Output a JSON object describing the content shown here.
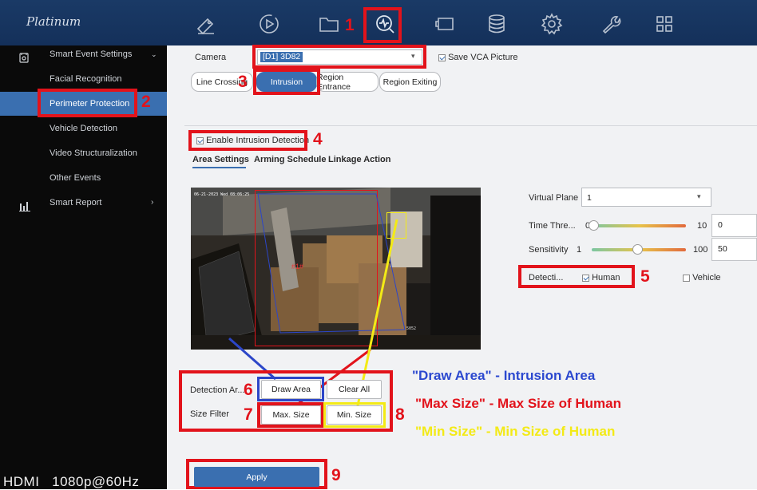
{
  "brand": "Platinum",
  "nav": {
    "icons": [
      "camera-icon",
      "playback-icon",
      "folder-icon",
      "smart-event-icon",
      "display-icon",
      "storage-icon",
      "settings-icon",
      "maintenance-icon",
      "apps-icon"
    ],
    "active_index": 3
  },
  "sidebar": {
    "items": [
      {
        "label": "Smart Event Settings",
        "icon": "smart-event-settings-icon"
      },
      {
        "label": "Facial Recognition"
      },
      {
        "label": "Perimeter Protection"
      },
      {
        "label": "Vehicle Detection"
      },
      {
        "label": "Video Structuralization"
      },
      {
        "label": "Other Events"
      },
      {
        "label": "Smart Report",
        "icon": "bar-chart-icon"
      }
    ],
    "selected": "Perimeter Protection"
  },
  "status": {
    "output": "HDMI",
    "resolution": "1080p@60Hz"
  },
  "camera": {
    "label": "Camera",
    "value": "[D1] 3D82",
    "save_vca": "Save VCA Picture",
    "save_vca_checked": true
  },
  "event_tabs": [
    "Line Crossing",
    "Intrusion",
    "Region Entrance",
    "Region Exiting"
  ],
  "active_event_tab": "Intrusion",
  "enable": {
    "label": "Enable Intrusion Detection",
    "checked": true
  },
  "sub_tabs": [
    "Area Settings",
    "Arming Schedule",
    "Linkage Action"
  ],
  "active_sub_tab": "Area Settings",
  "preview": {
    "timestamp": "06-21-2023 Wed 08:06:25",
    "region_label": "#1#",
    "cam_label": "5052"
  },
  "settings": {
    "virtual_plane": {
      "label": "Virtual Plane",
      "value": "1"
    },
    "time_threshold": {
      "label": "Time Thre...",
      "min": "0",
      "max": "10",
      "value": "0",
      "level": 0.0
    },
    "sensitivity": {
      "label": "Sensitivity",
      "min": "1",
      "max": "100",
      "value": "50",
      "level": 0.5
    },
    "detection": {
      "label": "Detecti...",
      "human": "Human",
      "human_checked": true,
      "vehicle": "Vehicle",
      "vehicle_checked": false
    }
  },
  "detection_area": {
    "label": "Detection Ar...",
    "draw": "Draw Area",
    "clear": "Clear All"
  },
  "size_filter": {
    "label": "Size Filter",
    "max": "Max. Size",
    "min": "Min. Size"
  },
  "apply": "Apply",
  "callouts": [
    "1",
    "2",
    "3",
    "4",
    "5",
    "6",
    "7",
    "8",
    "9"
  ],
  "captions": [
    {
      "text": "\"Draw Area\" - Intrusion Area",
      "color": "#2b48cf"
    },
    {
      "text": "\"Max Size\" - Max Size of Human",
      "color": "#e2131b"
    },
    {
      "text": "\"Min Size\" - Min Size of Human",
      "color": "#f3ea16"
    }
  ],
  "colors": {
    "accent": "#3a6fb0",
    "callout_red": "#e2131b",
    "max_blue": "#2c46c8",
    "min_yellow": "#f3ea16"
  }
}
